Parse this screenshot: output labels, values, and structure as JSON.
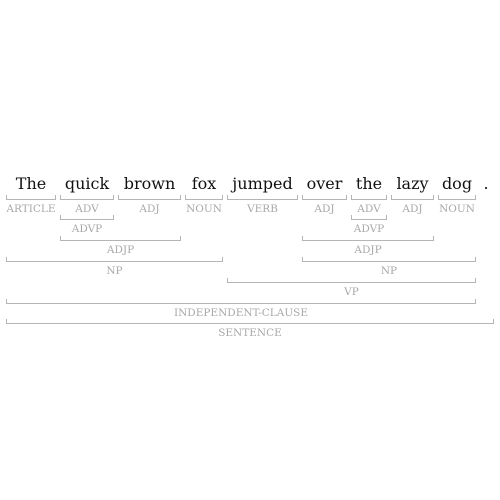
{
  "sentence": {
    "words": [
      "The",
      "quick",
      "brown",
      "fox",
      "jumped",
      "over",
      "the",
      "lazy",
      "dog",
      "."
    ],
    "pos_tags": [
      "ARTICLE",
      "ADV",
      "ADJ",
      "NOUN",
      "VERB",
      "ADJ",
      "ADV",
      "ADJ",
      "NOUN",
      ""
    ]
  },
  "phrases": [
    {
      "label": "ADVP",
      "start": 1,
      "end": 1
    },
    {
      "label": "ADVP",
      "start": 6,
      "end": 6
    },
    {
      "label": "ADJP",
      "start": 1,
      "end": 2
    },
    {
      "label": "ADJP",
      "start": 5,
      "end": 7
    },
    {
      "label": "NP",
      "start": 0,
      "end": 3
    },
    {
      "label": "NP",
      "start": 5,
      "end": 8
    },
    {
      "label": "VP",
      "start": 4,
      "end": 8
    },
    {
      "label": "INDEPENDENT-CLAUSE",
      "start": 0,
      "end": 8
    },
    {
      "label": "SENTENCE",
      "start": 0,
      "end": 9
    }
  ]
}
